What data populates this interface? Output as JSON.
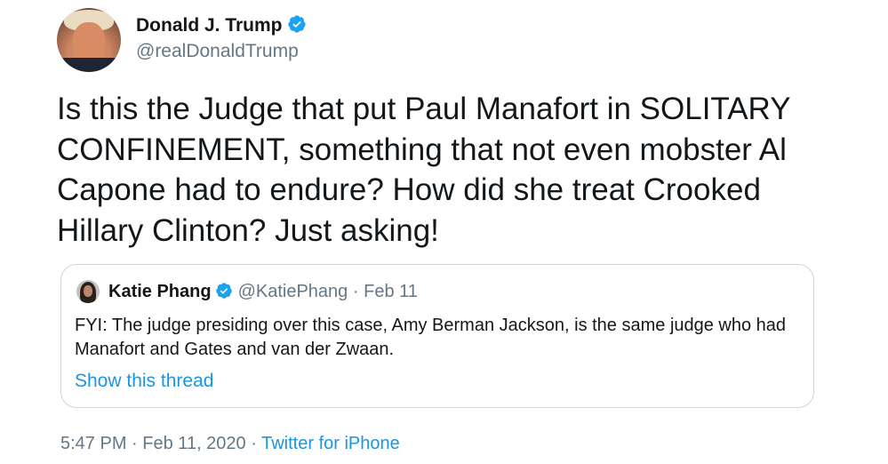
{
  "tweet": {
    "author_name": "Donald J. Trump",
    "author_handle": "@realDonaldTrump",
    "verified": true,
    "text": "Is this the Judge that put Paul Manafort in SOLITARY CONFINEMENT, something that not even mobster Al Capone had to endure? How did she treat Crooked Hillary Clinton? Just asking!",
    "time": "5:47 PM",
    "separator": "·",
    "date": "Feb 11, 2020",
    "source": "Twitter for iPhone"
  },
  "quoted_tweet": {
    "author_name": "Katie Phang",
    "verified": true,
    "author_handle": "@KatiePhang",
    "separator": "·",
    "date": "Feb 11",
    "text": "FYI: The judge presiding over this case, Amy Berman Jackson, is the same judge who had Manafort and Gates and van der Zwaan.",
    "show_thread_label": "Show this thread"
  },
  "colors": {
    "verified_badge": "#1da1f2",
    "link": "#1b95e0",
    "secondary_text": "#657786",
    "primary_text": "#14171a",
    "border": "#ccd6dd"
  },
  "icons": {
    "verified": "verified-badge-icon"
  }
}
